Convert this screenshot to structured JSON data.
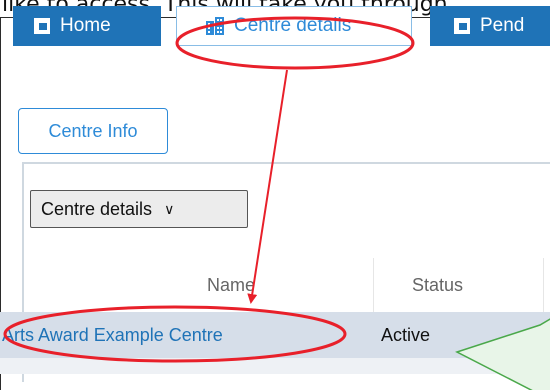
{
  "intro_text": "like to access. This will take you through",
  "nav": {
    "tabs": [
      {
        "label": "Home",
        "icon": "document-icon",
        "active": false
      },
      {
        "label": "Centre details",
        "icon": "building-icon",
        "active": true
      },
      {
        "label": "Pend",
        "icon": "document-icon",
        "active": false
      }
    ]
  },
  "subtab": {
    "label": "Centre Info"
  },
  "selector": {
    "value": "Centre details",
    "icon": "chevron-down-icon"
  },
  "table": {
    "columns": [
      "Name",
      "Status"
    ],
    "rows": [
      {
        "name": "Arts Award Example Centre",
        "status": "Active"
      }
    ]
  },
  "colors": {
    "primary": "#1f73b7",
    "link": "#2e8bd8",
    "annotation": "#e8202a",
    "callout_border": "#4aa84a",
    "callout_fill": "#e8f5e8",
    "row_highlight": "#d6dee9"
  }
}
